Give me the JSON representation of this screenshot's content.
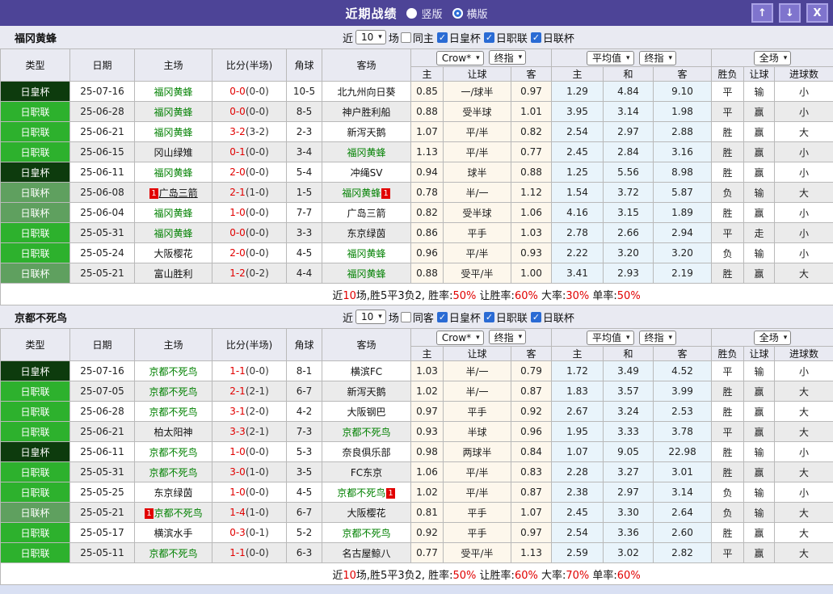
{
  "title_bar": {
    "title": "近期战绩",
    "radio_vertical": "竖版",
    "radio_horizontal": "横版",
    "selected": "横版",
    "buttons": {
      "up": "up-arrow",
      "down": "down-arrow",
      "close": "close-x"
    }
  },
  "colors": {
    "purple": "#4d4497",
    "btnfill": "#7f74cd",
    "btnborder": "#a9a1e5",
    "emp": "#0d3b0d",
    "j1": "#2db12d",
    "lc": "#5fa05f",
    "red": "#e10000",
    "blue": "#2222cc",
    "green": "#008000",
    "cream": "#fdf7ec",
    "lightblue": "#e9f4fb",
    "headerbg": "#e9eaf2",
    "rowalt": "#ebebeb",
    "pagebg": "#d9e0f3",
    "checkblue": "#2a6bd4"
  },
  "columns_main": [
    "类型",
    "日期",
    "主场",
    "比分(半场)",
    "角球",
    "客场"
  ],
  "columns_sub": [
    "主",
    "让球",
    "客",
    "主",
    "和",
    "客",
    "胜负",
    "让球",
    "进球数"
  ],
  "header_controls": {
    "odds_company": "Crow*",
    "odds_stage": "终指",
    "avg_type": "平均值",
    "avg_stage": "终指",
    "scope": "全场"
  },
  "sections": [
    {
      "team": "福冈黄蜂",
      "filter": {
        "near": "近",
        "count": "10",
        "unit": "场",
        "same": "同主",
        "same_checked": false,
        "cups": [
          "日皇杯",
          "日职联",
          "日联杯"
        ],
        "cups_checked": [
          true,
          true,
          true
        ]
      },
      "rows": [
        {
          "type": "日皇杯",
          "tc": "emp",
          "date": "25-07-16",
          "home": {
            "n": "福冈黄蜂",
            "self": 1
          },
          "score": "0-0",
          "half": "(0-0)",
          "corner": "10-5",
          "away": {
            "n": "北九州向日葵"
          },
          "o": [
            "0.85",
            "一/球半",
            "0.97"
          ],
          "a": [
            "1.29",
            "4.84",
            "9.10"
          ],
          "r": [
            [
              "平",
              "g"
            ],
            [
              "输",
              "b"
            ],
            [
              "小",
              "b"
            ]
          ]
        },
        {
          "type": "日职联",
          "tc": "j1",
          "date": "25-06-28",
          "home": {
            "n": "福冈黄蜂",
            "self": 1
          },
          "score": "0-0",
          "half": "(0-0)",
          "corner": "8-5",
          "away": {
            "n": "神户胜利船"
          },
          "o": [
            "0.88",
            "受半球",
            "1.01"
          ],
          "a": [
            "3.95",
            "3.14",
            "1.98"
          ],
          "r": [
            [
              "平",
              "g"
            ],
            [
              "赢",
              "r"
            ],
            [
              "小",
              "b"
            ]
          ]
        },
        {
          "type": "日职联",
          "tc": "j1",
          "date": "25-06-21",
          "home": {
            "n": "福冈黄蜂",
            "self": 1
          },
          "score": "3-2",
          "half": "(3-2)",
          "corner": "2-3",
          "away": {
            "n": "新泻天鹅"
          },
          "o": [
            "1.07",
            "平/半",
            "0.82"
          ],
          "a": [
            "2.54",
            "2.97",
            "2.88"
          ],
          "r": [
            [
              "胜",
              "r"
            ],
            [
              "赢",
              "r"
            ],
            [
              "大",
              "r"
            ]
          ]
        },
        {
          "type": "日职联",
          "tc": "j1",
          "date": "25-06-15",
          "home": {
            "n": "冈山绿雉"
          },
          "score": "0-1",
          "half": "(0-0)",
          "corner": "3-4",
          "away": {
            "n": "福冈黄蜂",
            "self": 1
          },
          "o": [
            "1.13",
            "平/半",
            "0.77"
          ],
          "a": [
            "2.45",
            "2.84",
            "3.16"
          ],
          "r": [
            [
              "胜",
              "r"
            ],
            [
              "赢",
              "r"
            ],
            [
              "小",
              "b"
            ]
          ]
        },
        {
          "type": "日皇杯",
          "tc": "emp",
          "date": "25-06-11",
          "home": {
            "n": "福冈黄蜂",
            "self": 1
          },
          "score": "2-0",
          "half": "(0-0)",
          "corner": "5-4",
          "away": {
            "n": "冲绳SV"
          },
          "o": [
            "0.94",
            "球半",
            "0.88"
          ],
          "a": [
            "1.25",
            "5.56",
            "8.98"
          ],
          "r": [
            [
              "胜",
              "r"
            ],
            [
              "赢",
              "r"
            ],
            [
              "小",
              "b"
            ]
          ]
        },
        {
          "type": "日联杯",
          "tc": "lc",
          "date": "25-06-08",
          "home": {
            "n": "广岛三箭",
            "b": "1",
            "bp": "before",
            "u": 1
          },
          "score": "2-1",
          "half": "(1-0)",
          "corner": "1-5",
          "away": {
            "n": "福冈黄蜂",
            "self": 1,
            "b": "1",
            "bp": "after"
          },
          "o": [
            "0.78",
            "半/一",
            "1.12"
          ],
          "a": [
            "1.54",
            "3.72",
            "5.87"
          ],
          "r": [
            [
              "负",
              "b"
            ],
            [
              "输",
              "b"
            ],
            [
              "大",
              "r"
            ]
          ]
        },
        {
          "type": "日联杯",
          "tc": "lc",
          "date": "25-06-04",
          "home": {
            "n": "福冈黄蜂",
            "self": 1
          },
          "score": "1-0",
          "half": "(0-0)",
          "corner": "7-7",
          "away": {
            "n": "广岛三箭"
          },
          "o": [
            "0.82",
            "受半球",
            "1.06"
          ],
          "a": [
            "4.16",
            "3.15",
            "1.89"
          ],
          "r": [
            [
              "胜",
              "r"
            ],
            [
              "赢",
              "r"
            ],
            [
              "小",
              "b"
            ]
          ]
        },
        {
          "type": "日职联",
          "tc": "j1",
          "date": "25-05-31",
          "home": {
            "n": "福冈黄蜂",
            "self": 1
          },
          "score": "0-0",
          "half": "(0-0)",
          "corner": "3-3",
          "away": {
            "n": "东京绿茵"
          },
          "o": [
            "0.86",
            "平手",
            "1.03"
          ],
          "a": [
            "2.78",
            "2.66",
            "2.94"
          ],
          "r": [
            [
              "平",
              "g"
            ],
            [
              "走",
              "g"
            ],
            [
              "小",
              "b"
            ]
          ]
        },
        {
          "type": "日职联",
          "tc": "j1",
          "date": "25-05-24",
          "home": {
            "n": "大阪樱花"
          },
          "score": "2-0",
          "half": "(0-0)",
          "corner": "4-5",
          "away": {
            "n": "福冈黄蜂",
            "self": 1
          },
          "o": [
            "0.96",
            "平/半",
            "0.93"
          ],
          "a": [
            "2.22",
            "3.20",
            "3.20"
          ],
          "r": [
            [
              "负",
              "b"
            ],
            [
              "输",
              "b"
            ],
            [
              "小",
              "b"
            ]
          ]
        },
        {
          "type": "日联杯",
          "tc": "lc",
          "date": "25-05-21",
          "home": {
            "n": "富山胜利"
          },
          "score": "1-2",
          "half": "(0-2)",
          "corner": "4-4",
          "away": {
            "n": "福冈黄蜂",
            "self": 1
          },
          "o": [
            "0.88",
            "受平/半",
            "1.00"
          ],
          "a": [
            "3.41",
            "2.93",
            "2.19"
          ],
          "r": [
            [
              "胜",
              "r"
            ],
            [
              "赢",
              "r"
            ],
            [
              "大",
              "r"
            ]
          ]
        }
      ],
      "footer": [
        [
          "近",
          0
        ],
        [
          "10",
          1
        ],
        [
          "场,胜5平3负2, 胜率:",
          0
        ],
        [
          "50%",
          1
        ],
        [
          " 让胜率:",
          0
        ],
        [
          "60%",
          1
        ],
        [
          " 大率:",
          0
        ],
        [
          "30%",
          1
        ],
        [
          " 单率:",
          0
        ],
        [
          "50%",
          1
        ]
      ]
    },
    {
      "team": "京都不死鸟",
      "filter": {
        "near": "近",
        "count": "10",
        "unit": "场",
        "same": "同客",
        "same_checked": false,
        "cups": [
          "日皇杯",
          "日职联",
          "日联杯"
        ],
        "cups_checked": [
          true,
          true,
          true
        ]
      },
      "rows": [
        {
          "type": "日皇杯",
          "tc": "emp",
          "date": "25-07-16",
          "home": {
            "n": "京都不死鸟",
            "self": 1
          },
          "score": "1-1",
          "half": "(0-0)",
          "corner": "8-1",
          "away": {
            "n": "横滨FC"
          },
          "o": [
            "1.03",
            "半/一",
            "0.79"
          ],
          "a": [
            "1.72",
            "3.49",
            "4.52"
          ],
          "r": [
            [
              "平",
              "g"
            ],
            [
              "输",
              "b"
            ],
            [
              "小",
              "b"
            ]
          ]
        },
        {
          "type": "日职联",
          "tc": "j1",
          "date": "25-07-05",
          "home": {
            "n": "京都不死鸟",
            "self": 1
          },
          "score": "2-1",
          "half": "(2-1)",
          "corner": "6-7",
          "away": {
            "n": "新泻天鹅"
          },
          "o": [
            "1.02",
            "半/一",
            "0.87"
          ],
          "a": [
            "1.83",
            "3.57",
            "3.99"
          ],
          "r": [
            [
              "胜",
              "r"
            ],
            [
              "赢",
              "r"
            ],
            [
              "大",
              "r"
            ]
          ]
        },
        {
          "type": "日职联",
          "tc": "j1",
          "date": "25-06-28",
          "home": {
            "n": "京都不死鸟",
            "self": 1
          },
          "score": "3-1",
          "half": "(2-0)",
          "corner": "4-2",
          "away": {
            "n": "大阪钢巴"
          },
          "o": [
            "0.97",
            "平手",
            "0.92"
          ],
          "a": [
            "2.67",
            "3.24",
            "2.53"
          ],
          "r": [
            [
              "胜",
              "r"
            ],
            [
              "赢",
              "r"
            ],
            [
              "大",
              "r"
            ]
          ]
        },
        {
          "type": "日职联",
          "tc": "j1",
          "date": "25-06-21",
          "home": {
            "n": "柏太阳神"
          },
          "score": "3-3",
          "half": "(2-1)",
          "corner": "7-3",
          "away": {
            "n": "京都不死鸟",
            "self": 1
          },
          "o": [
            "0.93",
            "半球",
            "0.96"
          ],
          "a": [
            "1.95",
            "3.33",
            "3.78"
          ],
          "r": [
            [
              "平",
              "g"
            ],
            [
              "赢",
              "r"
            ],
            [
              "大",
              "r"
            ]
          ]
        },
        {
          "type": "日皇杯",
          "tc": "emp",
          "date": "25-06-11",
          "home": {
            "n": "京都不死鸟",
            "self": 1
          },
          "score": "1-0",
          "half": "(0-0)",
          "corner": "5-3",
          "away": {
            "n": "奈良俱乐部"
          },
          "o": [
            "0.98",
            "两球半",
            "0.84"
          ],
          "a": [
            "1.07",
            "9.05",
            "22.98"
          ],
          "r": [
            [
              "胜",
              "r"
            ],
            [
              "输",
              "b"
            ],
            [
              "小",
              "b"
            ]
          ]
        },
        {
          "type": "日职联",
          "tc": "j1",
          "date": "25-05-31",
          "home": {
            "n": "京都不死鸟",
            "self": 1
          },
          "score": "3-0",
          "half": "(1-0)",
          "corner": "3-5",
          "away": {
            "n": "FC东京"
          },
          "o": [
            "1.06",
            "平/半",
            "0.83"
          ],
          "a": [
            "2.28",
            "3.27",
            "3.01"
          ],
          "r": [
            [
              "胜",
              "r"
            ],
            [
              "赢",
              "r"
            ],
            [
              "大",
              "r"
            ]
          ]
        },
        {
          "type": "日职联",
          "tc": "j1",
          "date": "25-05-25",
          "home": {
            "n": "东京绿茵"
          },
          "score": "1-0",
          "half": "(0-0)",
          "corner": "4-5",
          "away": {
            "n": "京都不死鸟",
            "self": 1,
            "b": "1",
            "bp": "after"
          },
          "o": [
            "1.02",
            "平/半",
            "0.87"
          ],
          "a": [
            "2.38",
            "2.97",
            "3.14"
          ],
          "r": [
            [
              "负",
              "b"
            ],
            [
              "输",
              "b"
            ],
            [
              "小",
              "b"
            ]
          ]
        },
        {
          "type": "日联杯",
          "tc": "lc",
          "date": "25-05-21",
          "home": {
            "n": "京都不死鸟",
            "self": 1,
            "b": "1",
            "bp": "before"
          },
          "score": "1-4",
          "half": "(1-0)",
          "corner": "6-7",
          "away": {
            "n": "大阪樱花"
          },
          "o": [
            "0.81",
            "平手",
            "1.07"
          ],
          "a": [
            "2.45",
            "3.30",
            "2.64"
          ],
          "r": [
            [
              "负",
              "b"
            ],
            [
              "输",
              "b"
            ],
            [
              "大",
              "r"
            ]
          ]
        },
        {
          "type": "日职联",
          "tc": "j1",
          "date": "25-05-17",
          "home": {
            "n": "横滨水手"
          },
          "score": "0-3",
          "half": "(0-1)",
          "corner": "5-2",
          "away": {
            "n": "京都不死鸟",
            "self": 1
          },
          "o": [
            "0.92",
            "平手",
            "0.97"
          ],
          "a": [
            "2.54",
            "3.36",
            "2.60"
          ],
          "r": [
            [
              "胜",
              "r"
            ],
            [
              "赢",
              "r"
            ],
            [
              "大",
              "r"
            ]
          ]
        },
        {
          "type": "日职联",
          "tc": "j1",
          "date": "25-05-11",
          "home": {
            "n": "京都不死鸟",
            "self": 1
          },
          "score": "1-1",
          "half": "(0-0)",
          "corner": "6-3",
          "away": {
            "n": "名古屋鲸八"
          },
          "o": [
            "0.77",
            "受平/半",
            "1.13"
          ],
          "a": [
            "2.59",
            "3.02",
            "2.82"
          ],
          "r": [
            [
              "平",
              "g"
            ],
            [
              "赢",
              "r"
            ],
            [
              "大",
              "r"
            ]
          ]
        }
      ],
      "footer": [
        [
          "近",
          0
        ],
        [
          "10",
          1
        ],
        [
          "场,胜5平3负2, 胜率:",
          0
        ],
        [
          "50%",
          1
        ],
        [
          " 让胜率:",
          0
        ],
        [
          "60%",
          1
        ],
        [
          " 大率:",
          0
        ],
        [
          "70%",
          1
        ],
        [
          " 单率:",
          0
        ],
        [
          "60%",
          1
        ]
      ]
    }
  ]
}
